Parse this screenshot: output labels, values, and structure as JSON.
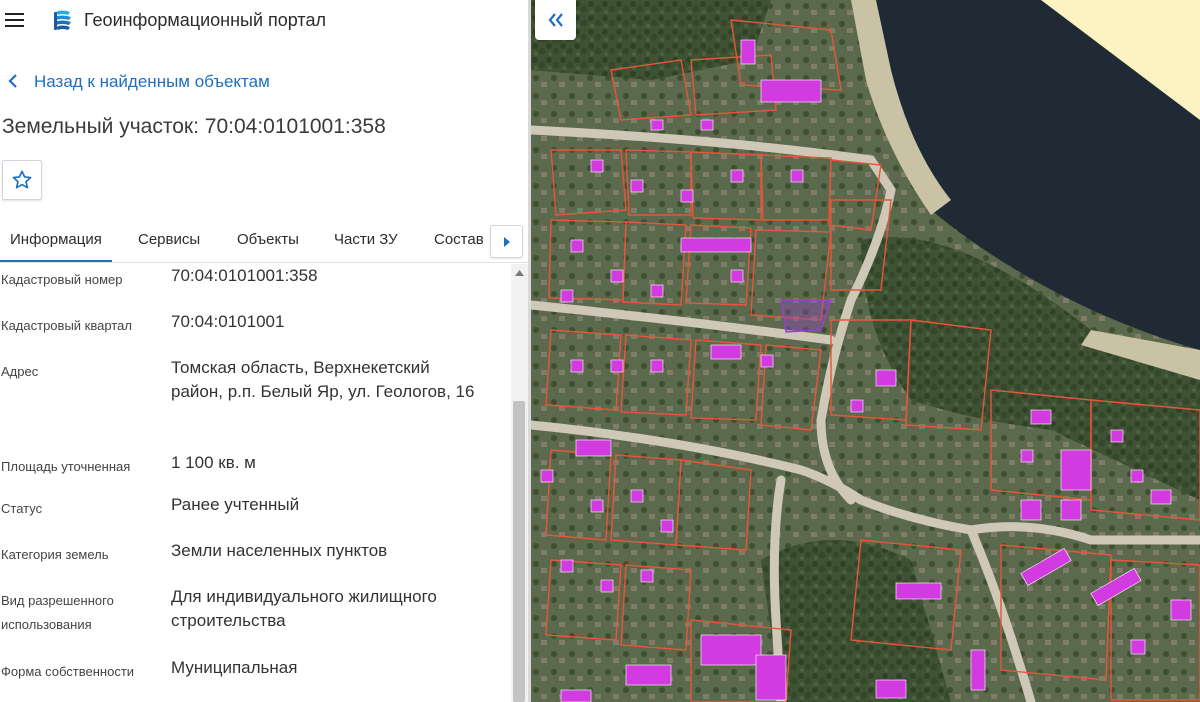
{
  "app": {
    "title": "Геоинформационный портал"
  },
  "nav": {
    "back_label": "Назад к найденным объектам"
  },
  "object": {
    "title": "Земельный участок: 70:04:0101001:358"
  },
  "tabs": [
    {
      "label": "Информация",
      "active": true
    },
    {
      "label": "Сервисы"
    },
    {
      "label": "Объекты"
    },
    {
      "label": "Части ЗУ"
    },
    {
      "label": "Состав"
    }
  ],
  "properties": [
    {
      "key": "Кадастровый номер",
      "value": "70:04:0101001:358"
    },
    {
      "key": "Кадастровый квартал",
      "value": "70:04:0101001"
    },
    {
      "key": "Адрес",
      "value": "Томская область, Верхнекетский район, р.п. Белый Яр, ул. Геологов, 16"
    },
    {
      "key": "Площадь уточненная",
      "value": "1 100 кв. м"
    },
    {
      "key": "Статус",
      "value": "Ранее учтенный"
    },
    {
      "key": "Категория земель",
      "value": "Земли населенных пунктов"
    },
    {
      "key": "Вид разрешенного использования",
      "value": "Для индивидуального жилищного строительства"
    },
    {
      "key": "Форма собственности",
      "value": "Муниципальная"
    }
  ],
  "icons": {
    "menu": "hamburger-icon",
    "logo": "portal-logo",
    "back": "chevron-left-icon",
    "favorite": "star-icon",
    "tab_scroll": "triangle-right-icon",
    "map_collapse": "double-chevron-left-icon"
  },
  "colors": {
    "accent": "#1e6fc0",
    "parcel_outline": "#e8553a",
    "building_fill": "#d13be0",
    "river": "#202a35",
    "selected_parcel": "#9c3fd0"
  }
}
